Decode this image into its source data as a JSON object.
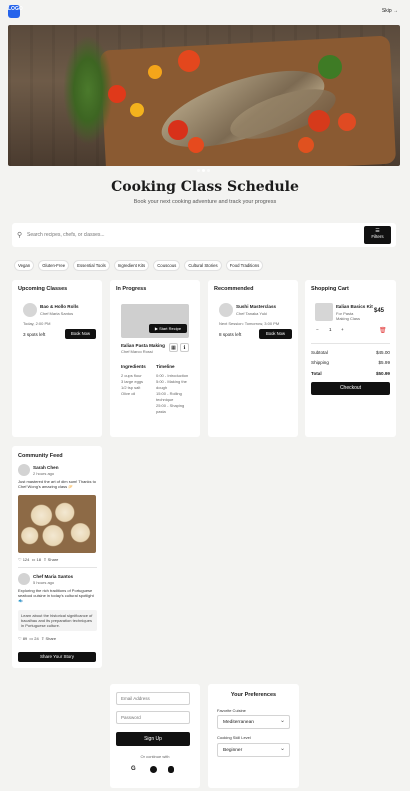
{
  "header": {
    "logo_text": "LOGO",
    "skip_label": "Skip →"
  },
  "hero": {
    "slides": 3,
    "active": 1
  },
  "page": {
    "title": "Cooking Class Schedule",
    "subtitle": "Book your next cooking adventure and track your progress"
  },
  "search": {
    "placeholder": "Search recipes, chefs, or classes...",
    "filter_label": "Filters",
    "filter_icon": "filter-icon"
  },
  "filters": [
    "Vegan",
    "Gluten-Free",
    "Essential Tools",
    "Ingredient Kits",
    "Couscous",
    "Cultural Stories",
    "Food Traditions"
  ],
  "upcoming": {
    "title": "Upcoming Classes",
    "item": {
      "name": "Bao & Hollo Rolls",
      "chef": "Chef Maria Santos",
      "time": "Today, 2:00 PM",
      "spots": "3 spots left",
      "button": "Book Now"
    }
  },
  "in_progress": {
    "title": "In Progress",
    "start_label": "Start Recipe",
    "recipe_title": "Italian Pasta Making",
    "chef": "Chef Marco Rossi",
    "ingredients_title": "Ingredients",
    "ingredients": [
      "2 cups flour",
      "3 large eggs",
      "1/2 tsp salt",
      "Olive oil"
    ],
    "timeline_title": "Timeline",
    "timeline": [
      "0:00 - Introduction",
      "5:00 - Making the dough",
      "15:00 - Rolling technique",
      "25:00 - Shaping pasta"
    ]
  },
  "recommended": {
    "title": "Recommended",
    "item": {
      "name": "Sushi Masterclass",
      "chef": "Chef Tanaka Yuki",
      "time": "Next Session: Tomorrow, 3:00 PM",
      "spots": "8 spots left",
      "button": "Book Now"
    }
  },
  "cart": {
    "title": "Shopping Cart",
    "item": {
      "name": "Italian Basics Kit",
      "desc": "For Pasta Making Class",
      "price": "$45",
      "qty": "1",
      "minus": "−",
      "plus": "+"
    },
    "subtotal_label": "Subtotal",
    "subtotal": "$45.00",
    "shipping_label": "Shipping",
    "shipping": "$5.99",
    "total_label": "Total",
    "total": "$50.99",
    "checkout_label": "Checkout"
  },
  "community": {
    "title": "Community Feed",
    "posts": [
      {
        "author": "Sarah Chen",
        "time": "2 hours ago",
        "text": "Just mastered the art of dim sum! Thanks to Chef Wong's amazing class 🥟",
        "likes": "124",
        "comments": "18",
        "share": "Share"
      },
      {
        "author": "Chef Maria Santos",
        "time": "5 hours ago",
        "text": "Exploring the rich traditions of Portuguese seafood cuisine in today's cultural spotlight 🐟",
        "quote": "Learn about the historical significance of bacalhau and its preparation techniques in Portuguese culture.",
        "likes": "89",
        "comments": "24",
        "share": "Share"
      }
    ],
    "share_button": "Share Your Story"
  },
  "signup": {
    "email_placeholder": "Email Address",
    "password_placeholder": "Password",
    "button": "Sign Up",
    "or_text": "Or continue with",
    "providers": [
      "G",
      "",
      ""
    ]
  },
  "preferences": {
    "title": "Your Preferences",
    "cuisine_label": "Favorite Cuisine",
    "cuisine_value": "Mediterranean",
    "skill_label": "Cooking Skill Level",
    "skill_value": "Beginner"
  }
}
